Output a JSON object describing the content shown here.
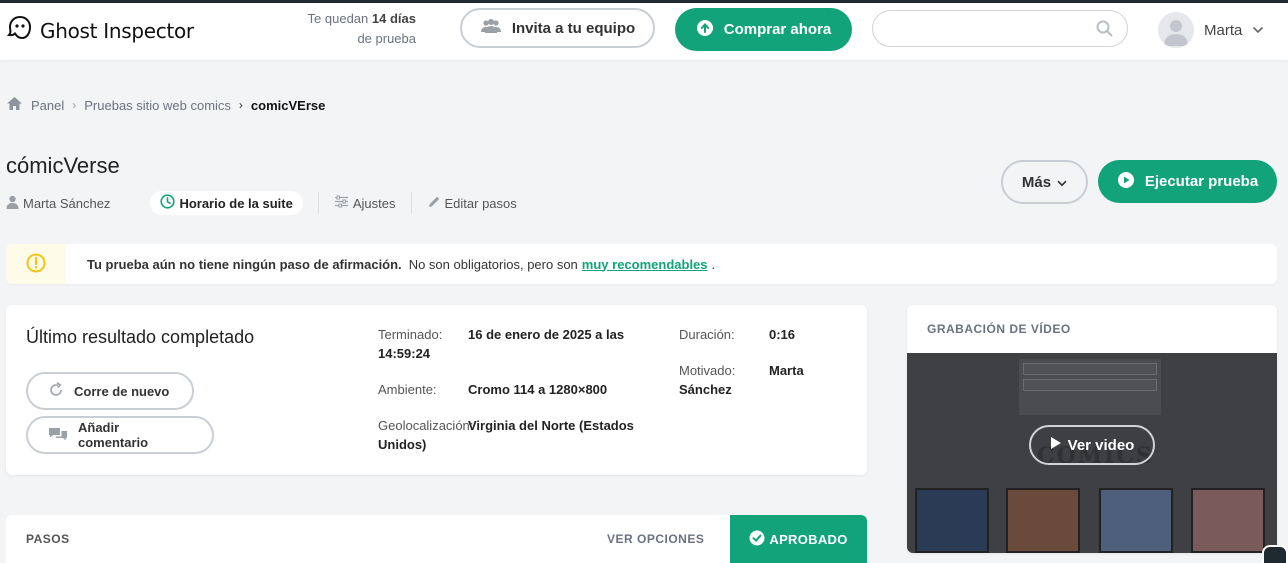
{
  "header": {
    "logo_text": "Ghost Inspector",
    "trial_prefix": "Te quedan",
    "trial_days": "14 días",
    "trial_suffix": "de prueba",
    "invite_label": "Invita a tu equipo",
    "buy_label": "Comprar ahora",
    "search_placeholder": "",
    "user_name": "Marta"
  },
  "breadcrumb": {
    "items": [
      "Panel",
      "Pruebas sitio web comics",
      "comicVErse"
    ]
  },
  "test": {
    "title": "cómicVerse",
    "owner": "Marta Sánchez",
    "schedule_label": "Horario de la suite",
    "settings_label": "Ajustes",
    "edit_steps_label": "Editar pasos",
    "more_label": "Más",
    "run_label": "Ejecutar prueba"
  },
  "alert": {
    "strong": "Tu prueba aún no tiene ningún paso de afirmación.",
    "text": "No son obligatorios, pero son",
    "link": "muy recomendables",
    "end": "."
  },
  "result": {
    "title": "Último resultado completado",
    "rerun_label": "Corre de nuevo",
    "comment_label": "Añadir comentario",
    "finished_label": "Terminado:",
    "finished_value": "16 de enero de 2025 a las 14:59:24",
    "environment_label": "Ambiente:",
    "environment_value": "Cromo 114 a 1280×800",
    "geo_label": "Geolocalización:",
    "geo_value": "Virginia del Norte (Estados Unidos)",
    "duration_label": "Duración:",
    "duration_value": "0:16",
    "trigger_label": "Motivado:",
    "trigger_value": "Marta Sánchez"
  },
  "video": {
    "title": "GRABACIÓN DE VÍDEO",
    "play_label": "Ver video",
    "screen_heading": "COMICS"
  },
  "steps": {
    "label": "PASOS",
    "options_label": "VER OPCIONES",
    "status_label": "APROBADO"
  },
  "colors": {
    "accent": "#12a37a",
    "warning": "#f5c518"
  }
}
